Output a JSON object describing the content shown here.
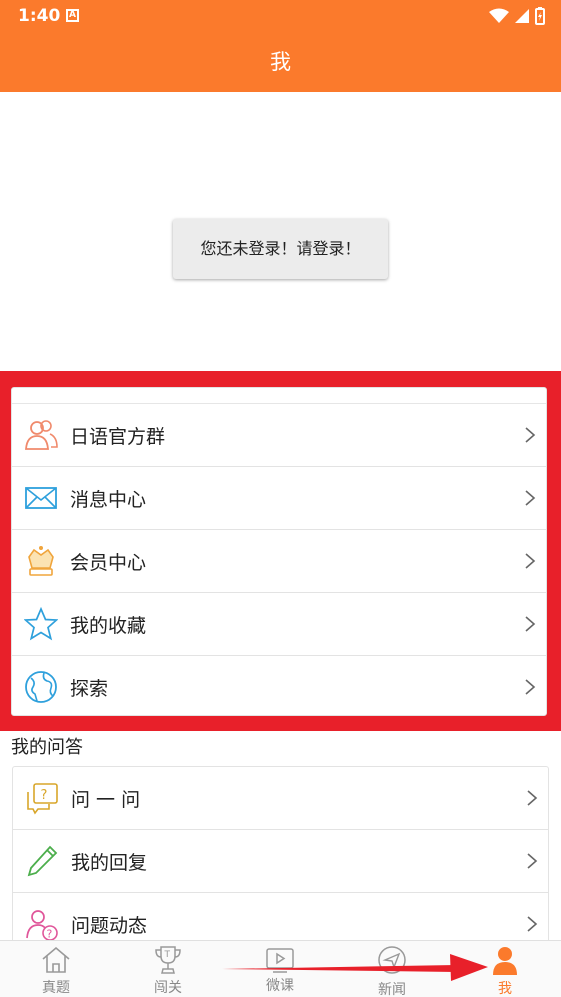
{
  "status": {
    "time": "1:40",
    "notification_icon": "A"
  },
  "header": {
    "title": "我"
  },
  "login": {
    "message": "您还未登录！请登录！"
  },
  "menu": {
    "items": [
      {
        "label": "日语官方群",
        "icon": "group-icon"
      },
      {
        "label": "消息中心",
        "icon": "mail-icon"
      },
      {
        "label": "会员中心",
        "icon": "crown-icon"
      },
      {
        "label": "我的收藏",
        "icon": "star-icon"
      },
      {
        "label": "探索",
        "icon": "globe-icon"
      }
    ]
  },
  "qa": {
    "title": "我的问答",
    "items": [
      {
        "label": "问 一 问",
        "icon": "question-bubble-icon"
      },
      {
        "label": "我的回复",
        "icon": "pencil-icon"
      },
      {
        "label": "问题动态",
        "icon": "user-question-icon"
      }
    ]
  },
  "tabs": [
    {
      "label": "真题",
      "icon": "home-icon"
    },
    {
      "label": "闯关",
      "icon": "trophy-icon"
    },
    {
      "label": "微课",
      "icon": "play-icon"
    },
    {
      "label": "新闻",
      "icon": "send-icon"
    },
    {
      "label": "我",
      "icon": "person-icon"
    }
  ],
  "colors": {
    "accent": "#fb7a2c",
    "highlight": "#e8202a"
  }
}
